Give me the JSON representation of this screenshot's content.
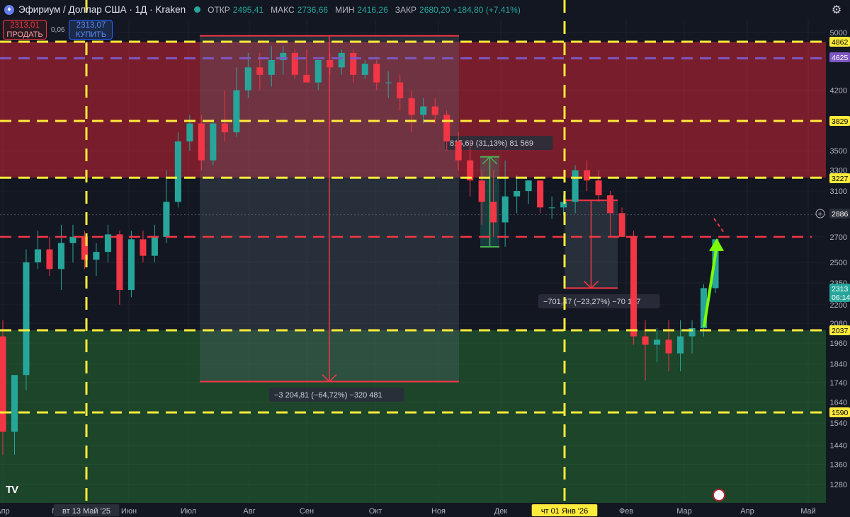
{
  "header": {
    "logo_icon": "ethereum-icon",
    "title": "Эфириум / Доллар США · 1Д · Kraken",
    "ohlc": [
      {
        "key": "ОТКР",
        "value": "2495,41"
      },
      {
        "key": "МАКС",
        "value": "2736,66"
      },
      {
        "key": "МИН",
        "value": "2416,26"
      },
      {
        "key": "ЗАКР",
        "value": "2680,20 +184,80 (+7,41%)"
      }
    ]
  },
  "trade": {
    "sell_price": "2313,01",
    "sell_label": "ПРОДАТЬ",
    "spread": "0,06",
    "buy_price": "2313,07",
    "buy_label": "КУПИТЬ"
  },
  "branding": {
    "logo": "TV",
    "flag_icon": "us-flag-icon",
    "settings_icon": "settings-icon"
  },
  "colors": {
    "background": "#131722",
    "up": "#26a69a",
    "down": "#f23645",
    "level": "#ffeb3b",
    "blue_level": "#7e57c2",
    "red_zone": "#8b1f2d",
    "green_zone": "#1e4d2b"
  },
  "chart_data": {
    "type": "candlestick",
    "title": "Эфириум / Доллар США · 1Д · Kraken",
    "y_scale": "log",
    "ylim": [
      1180,
      5300
    ],
    "x_ticks": [
      "Апр",
      "Май",
      "вт 13 Май '25",
      "Июн",
      "Июл",
      "Авг",
      "Сен",
      "Окт",
      "Ноя",
      "Дек",
      "чт 01 Янв '26",
      "Фев",
      "Мар",
      "Апр",
      "Май"
    ],
    "y_ticks": [
      "5000",
      "4200",
      "3500",
      "3300",
      "3100",
      "2700",
      "2500",
      "2350",
      "2200",
      "2080",
      "1960",
      "1840",
      "1740",
      "1640",
      "1540",
      "1440",
      "1360",
      "1280"
    ],
    "price_axis_labels": [
      {
        "text": "4862",
        "color": "#ffeb3b"
      },
      {
        "text": "4625",
        "color": "#7e57c2"
      },
      {
        "text": "3829",
        "color": "#ffeb3b"
      },
      {
        "text": "3227",
        "color": "#ffeb3b"
      },
      {
        "text": "2886",
        "color": "#2a2e39"
      },
      {
        "text": "2313",
        "color": "#26a69a"
      },
      {
        "text": "06:14",
        "color": "#26a69a"
      },
      {
        "text": "2037",
        "color": "#ffeb3b"
      },
      {
        "text": "1590",
        "color": "#ffeb3b"
      }
    ],
    "horizontal_levels": [
      {
        "price": 4862,
        "color": "#ffeb3b",
        "style": "dashed"
      },
      {
        "price": 4625,
        "color": "#7e57c2",
        "style": "dashed"
      },
      {
        "price": 3829,
        "color": "#ffeb3b",
        "style": "dashed"
      },
      {
        "price": 3227,
        "color": "#ffeb3b",
        "style": "dashed"
      },
      {
        "price": 2037,
        "color": "#ffeb3b",
        "style": "dashed"
      },
      {
        "price": 1590,
        "color": "#ffeb3b",
        "style": "dashed"
      },
      {
        "price": 2700,
        "color": "#f23645",
        "style": "dashed"
      }
    ],
    "zones": [
      {
        "from": 3227,
        "to": 4862,
        "color": "#8b1f2d"
      },
      {
        "from": 1180,
        "to": 2037,
        "color": "#1e4d2b"
      }
    ],
    "vertical_markers": [
      "вт 13 Май '25",
      "чт 01 Янв '26"
    ],
    "measurements": [
      {
        "label": "−3 204,81 (−64,72%) −320 481",
        "direction": "down",
        "from": 4950,
        "to": 1745
      },
      {
        "label": "815,69 (31,13%) 81 569",
        "direction": "up",
        "from": 2620,
        "to": 3436
      },
      {
        "label": "−701,47 (−23,27%) −70 147",
        "direction": "down",
        "from": 3014,
        "to": 2313
      }
    ],
    "arrow": {
      "to": 2700,
      "color": "#7cfc00"
    },
    "series": [
      {
        "open": [
          2000,
          1500,
          1780,
          2500,
          2600,
          2450,
          2650,
          2700,
          2520,
          2580,
          2720,
          2300,
          2680,
          2550,
          2700,
          3000,
          3600,
          3800,
          3400,
          3800,
          3700,
          4200,
          4500,
          4400,
          4600,
          4700,
          4400,
          4300,
          4600,
          4500,
          4700,
          4400,
          4550,
          4300,
          4300,
          4100,
          3900,
          4000,
          3900,
          3600,
          3400,
          3200,
          3000,
          2820,
          3050,
          3100,
          3200,
          2950,
          2950,
          3000,
          3300,
          3200,
          3060,
          2900,
          2700,
          2000,
          1950,
          1980,
          1900,
          2000,
          2050,
          2313
        ],
        "high": [
          2100,
          1650,
          2600,
          2750,
          2700,
          2800,
          2800,
          2750,
          2650,
          2800,
          2750,
          2750,
          2750,
          2800,
          3300,
          3700,
          3900,
          3900,
          3850,
          4200,
          4500,
          4700,
          4700,
          4800,
          4800,
          4750,
          4750,
          4600,
          4700,
          4750,
          4750,
          4600,
          4600,
          4450,
          4400,
          4200,
          4100,
          4100,
          3950,
          3700,
          3600,
          3300,
          3300,
          3400,
          3250,
          3200,
          3200,
          3050,
          3060,
          3350,
          3400,
          3300,
          3100,
          2950,
          2750,
          2100,
          2050,
          2100,
          2100,
          2100,
          2340,
          2360
        ],
        "low": [
          1400,
          1400,
          1700,
          2450,
          2400,
          2300,
          2500,
          2450,
          2400,
          2500,
          2200,
          2250,
          2500,
          2500,
          2650,
          2950,
          3500,
          3300,
          3350,
          3600,
          3650,
          4100,
          4200,
          4250,
          4400,
          4350,
          4300,
          4200,
          4400,
          4400,
          4300,
          4350,
          4200,
          4100,
          3950,
          3700,
          3800,
          3800,
          3500,
          3300,
          3050,
          2800,
          2700,
          2620,
          2900,
          2980,
          2900,
          2850,
          2880,
          2900,
          3100,
          3000,
          2700,
          2700,
          1950,
          1750,
          1850,
          1800,
          1800,
          1900,
          2000,
          2280
        ],
        "close": [
          1500,
          1780,
          2500,
          2600,
          2450,
          2650,
          2700,
          2520,
          2580,
          2720,
          2300,
          2680,
          2550,
          2700,
          3000,
          3600,
          3800,
          3400,
          3800,
          3700,
          4200,
          4500,
          4400,
          4600,
          4700,
          4400,
          4300,
          4600,
          4500,
          4700,
          4400,
          4550,
          4300,
          4300,
          4100,
          3900,
          4000,
          3900,
          3600,
          3400,
          3200,
          3000,
          2820,
          3050,
          3100,
          3200,
          2950,
          2950,
          3000,
          3300,
          3200,
          3060,
          2900,
          2700,
          2000,
          1950,
          1980,
          1900,
          2000,
          2050,
          2313,
          2680
        ]
      }
    ]
  }
}
